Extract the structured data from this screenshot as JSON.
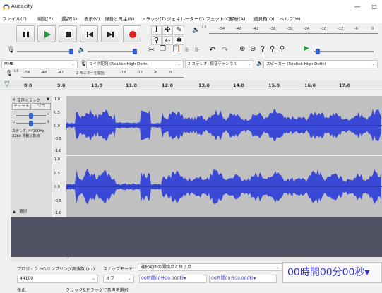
{
  "titlebar": {
    "app_title": "Audacity",
    "minimize": "—",
    "maximize": "□"
  },
  "menu": [
    "ファイル(F)",
    "編集(E)",
    "選択(S)",
    "表示(V)",
    "録音と再生(N)",
    "トラック(T)",
    "ジェネレーター(G)",
    "エフェクト(C)",
    "解析(A)",
    "道具箱(O)",
    "ヘルプ(H)"
  ],
  "meters": {
    "play_scale": [
      "-54",
      "-48",
      "-42",
      "-36",
      "-30",
      "-24",
      "-18",
      "-12",
      "-6",
      "0"
    ],
    "record_scale": [
      "-54",
      "-48",
      "-42",
      "2 モニターを開始",
      "-18",
      "-12",
      "-6",
      "0"
    ],
    "play_letters": "L R",
    "record_letters": "L R"
  },
  "devices": {
    "host": "MME",
    "input": "マイク配列 (Realtek High Defini",
    "channels": "2(ステレオ) 録音チャンネル",
    "output": "スピーカー (Realtek High Defini"
  },
  "ruler": {
    "ticks": [
      "8.0",
      "9.0",
      "10.0",
      "11.0",
      "12.0",
      "13.0",
      "14.0",
      "15.0",
      "16.0",
      "17.0"
    ]
  },
  "track": {
    "name": "音声トラック",
    "mute": "ミュート",
    "solo": "ソロ",
    "pan_l": "L",
    "pan_r": "R",
    "info_line1": "ステレオ, 44100Hz",
    "info_line2": "32bit 浮動小数点",
    "select": "選択"
  },
  "scale": {
    "ch1": [
      "1.0",
      "0.5",
      "0.0",
      "-0.5",
      "-1.0"
    ],
    "ch2": [
      "1.0",
      "0.5",
      "0.0",
      "-0.5",
      "-1.0"
    ]
  },
  "selection": {
    "rate_label": "プロジェクトのサンプリング周波数 (Hz)",
    "snap_label": "スナップモード",
    "range_label": "選択範囲の開始点と終了点",
    "rate_value": "44100",
    "snap_value": "オフ",
    "start": "00時間00分00.000秒",
    "end": "00時間00分00.000秒",
    "big_time": "00時間00分00秒"
  },
  "status": {
    "left": "停止.",
    "right": "クリック&ドラッグで音声を選択"
  },
  "colors": {
    "wave": "#3a48d6",
    "wave_bg": "#c0c0c0",
    "below_tracks": "#4f5263",
    "time_digits": "#3333cc"
  }
}
